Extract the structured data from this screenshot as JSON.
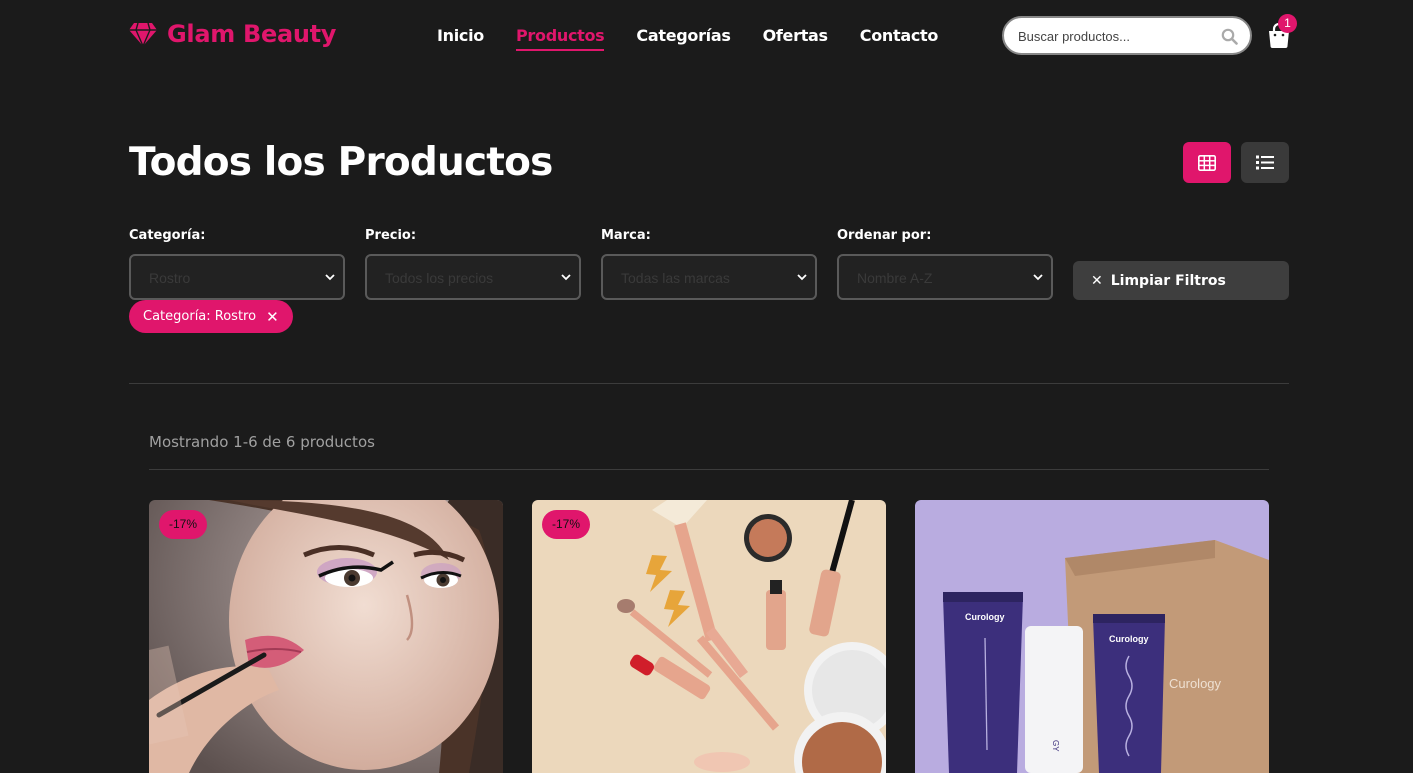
{
  "brand": {
    "name": "Glam Beauty",
    "color": "#e0166c"
  },
  "nav": [
    {
      "label": "Inicio",
      "active": false
    },
    {
      "label": "Productos",
      "active": true
    },
    {
      "label": "Categorías",
      "active": false
    },
    {
      "label": "Ofertas",
      "active": false
    },
    {
      "label": "Contacto",
      "active": false
    }
  ],
  "search": {
    "placeholder": "Buscar productos...",
    "icon": "search-icon"
  },
  "cart": {
    "count": "1",
    "icon": "shopping-bag-icon"
  },
  "page": {
    "title": "Todos los Productos"
  },
  "view_toggle": {
    "grid_icon": "grid-icon",
    "list_icon": "list-icon",
    "selected": "grid"
  },
  "filters": {
    "category": {
      "label": "Categoría:",
      "value": "Rostro"
    },
    "price": {
      "label": "Precio:",
      "value": "Todos los precios"
    },
    "brand": {
      "label": "Marca:",
      "value": "Todas las marcas"
    },
    "sort": {
      "label": "Ordenar por:",
      "value": "Nombre A-Z"
    },
    "clear_label": "Limpiar Filtros",
    "active_chip": "Categoría: Rostro"
  },
  "results": {
    "text": "Mostrando 1-6 de 6 productos"
  },
  "products": [
    {
      "discount": "-17%",
      "image": "makeup-model-photo"
    },
    {
      "discount": "-17%",
      "image": "makeup-flatlay-photo"
    },
    {
      "discount": "",
      "image": "curology-products-photo",
      "product_text_1": "Curology",
      "product_text_2": "Curology",
      "product_text_3": "Curology"
    }
  ]
}
